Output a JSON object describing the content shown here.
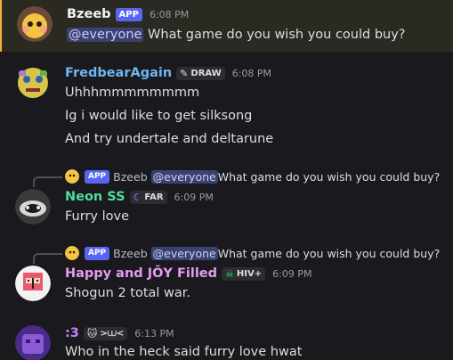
{
  "messages": [
    {
      "author": "Bzeeb",
      "name_color": "#f2f3f5",
      "app_badge": "APP",
      "timestamp": "6:08 PM",
      "mention": "@everyone",
      "text": " What game do you wish you could buy?",
      "highlighted": true
    },
    {
      "author": "FredbearAgain",
      "name_color": "#6fb6f0",
      "guild_tag": "DRAW",
      "guild_icon": "brush-icon",
      "timestamp": "6:08 PM",
      "lines": [
        "Uhhhmmmmmmmm",
        "Ig i would like to get silksong",
        "And try undertale and deltarune"
      ]
    },
    {
      "reply": {
        "app_badge": "APP",
        "author": "Bzeeb",
        "mention": "@everyone",
        "text": " What game do you wish you could buy?"
      },
      "author": "Neon SS",
      "name_color": "#4fdc9e",
      "guild_tag": "FAR",
      "guild_icon": "moon-icon",
      "timestamp": "6:09 PM",
      "text": "Furry love"
    },
    {
      "reply": {
        "app_badge": "APP",
        "author": "Bzeeb",
        "mention": "@everyone",
        "text": " What game do you wish you could buy?"
      },
      "author": "Happy and JŌY Filled",
      "name_color": "#e59cf0",
      "guild_tag": "HIV+",
      "guild_icon": "skull-icon",
      "timestamp": "6:09 PM",
      "text": "Shogun 2 total war."
    },
    {
      "author": ":3",
      "name_color": "#c77dff",
      "guild_tag": ">⩊<",
      "guild_icon": "cat-icon",
      "timestamp": "6:13 PM",
      "text": "Who in the heck said furry love hwat"
    }
  ],
  "colors": {
    "background": "#1a1a1e",
    "mention_bg": "#3c4270",
    "app_badge": "#5865f2",
    "highlight_border": "#f0b232"
  }
}
